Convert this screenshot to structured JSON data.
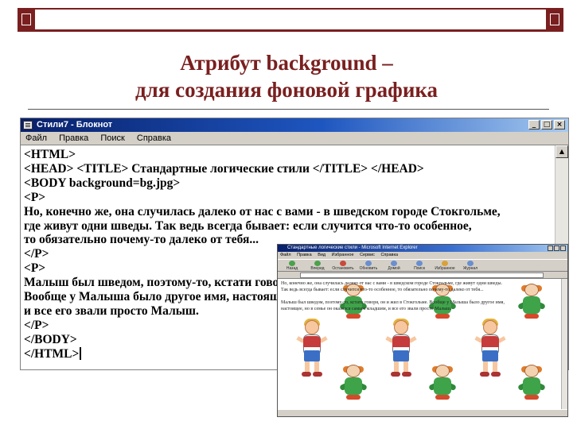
{
  "slide": {
    "title_line1": "Атрибут  background –",
    "title_line2": "для создания фоновой графика",
    "accent_color": "#7a1f1f"
  },
  "notepad": {
    "window_title": "Стили7 - Блокнот",
    "window_buttons": [
      "_",
      "□",
      "×"
    ],
    "menu": [
      "Файл",
      "Правка",
      "Поиск",
      "Справка"
    ],
    "lines": [
      "<HTML>",
      "<HEAD> <TITLE> Стандартные логические стили </TITLE> </HEAD>",
      "<BODY background=bg.jpg>",
      "<P>",
      "Но, конечно же, она случилась далеко от нас с вами - в шведском городе Стокгольме,",
      "где живут одни шведы. Так ведь всегда бывает: если случится что-то особенное,",
      "то обязательно почему-то далеко от тебя...",
      "</P>",
      "<P>",
      "Малыш был шведом, поэтому-то, кстати говоря, он и жил в Стокгольме.",
      "Вообще у Малыша было другое имя, настоящее, но в семье он оказался самым младшим,",
      "и все его звали просто Малыш.",
      "</P>",
      "</BODY>",
      "</HTML>"
    ]
  },
  "browser": {
    "window_title": "Стандартные логические стили - Microsoft Internet Explorer",
    "menu": [
      "Файл",
      "Правка",
      "Вид",
      "Избранное",
      "Сервис",
      "Справка"
    ],
    "toolbar": [
      "Назад",
      "Вперед",
      "Остановить",
      "Обновить",
      "Домой",
      "Поиск",
      "Избранное",
      "Журнал"
    ],
    "paragraph1_line1": "Но, конечно же, она случилась далеко от нас с вами - в шведском городе Стокгольме, где живут одни шведы.",
    "paragraph1_line2": "Так ведь всегда бывает: если случится что-то особенное, то обязательно почему-то далеко от тебя...",
    "paragraph2_line1": "Малыш был шведом, поэтому-то, кстати говоря, он и жил в Стокгольме. Вообще у Малыша было другое имя,",
    "paragraph2_line2": "настоящее, но в семье он оказался самым младшим, и все его звали просто Малыш."
  }
}
